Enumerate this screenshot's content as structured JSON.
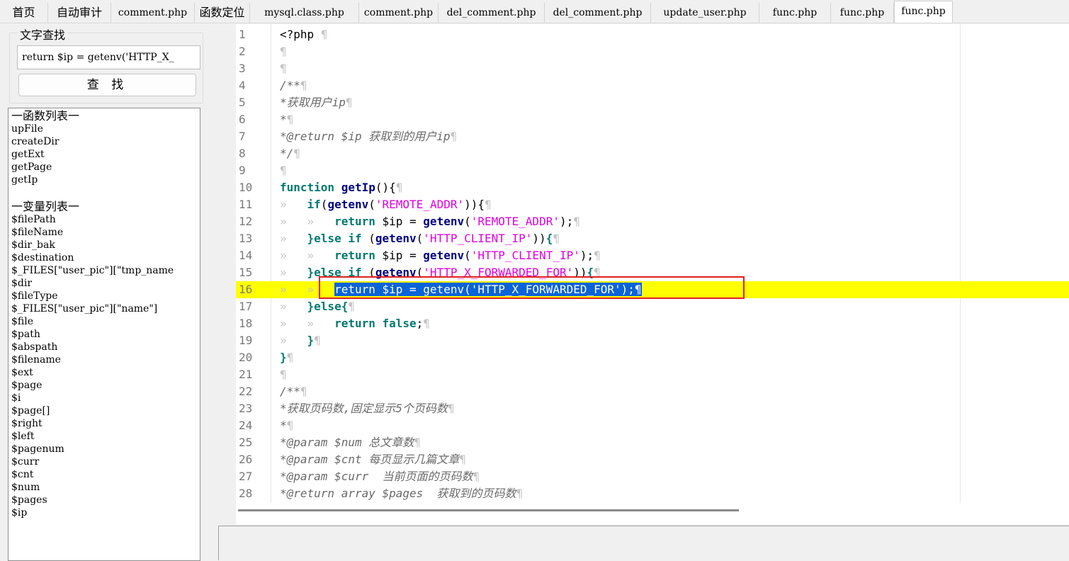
{
  "tabs": [
    {
      "label": "首页",
      "cn": true
    },
    {
      "label": "自动审计",
      "cn": true
    },
    {
      "label": "comment.php",
      "cn": false
    },
    {
      "label": "函数定位",
      "cn": true
    },
    {
      "label": "mysql.class.php",
      "cn": false
    },
    {
      "label": "comment.php",
      "cn": false
    },
    {
      "label": "del_comment.php",
      "cn": false
    },
    {
      "label": "del_comment.php",
      "cn": false
    },
    {
      "label": "update_user.php",
      "cn": false
    },
    {
      "label": "func.php",
      "cn": false
    },
    {
      "label": "func.php",
      "cn": false
    },
    {
      "label": "func.php",
      "cn": false,
      "active": true
    }
  ],
  "search": {
    "legend": "文字查找",
    "value": "return $ip = getenv('HTTP_X_",
    "button_label": "查 找"
  },
  "functions": {
    "header": "一函数列表一",
    "items": [
      "upFile",
      "createDir",
      "getExt",
      "getPage",
      "getIp"
    ]
  },
  "variables": {
    "header": "一变量列表一",
    "items": [
      "$filePath",
      "$fileName",
      "$dir_bak",
      "$destination",
      "$_FILES[\"user_pic\"][\"tmp_name",
      "$dir",
      "$fileType",
      "$_FILES[\"user_pic\"][\"name\"]",
      "$file",
      "$path",
      "$abspath",
      "$filename",
      "$ext",
      "$page",
      "$i",
      "$page[]",
      "$right",
      "$left",
      "$pagenum",
      "$curr",
      "$cnt",
      "$num",
      "$pages",
      "$ip"
    ]
  },
  "editor": {
    "highlighted_line": 16,
    "lines": [
      [
        [
          "op",
          "<?php"
        ],
        [
          "ws",
          " ¶"
        ]
      ],
      [
        [
          "ws",
          "¶"
        ]
      ],
      [
        [
          "ws",
          "¶"
        ]
      ],
      [
        [
          "cm",
          "/**"
        ],
        [
          "ws",
          "¶"
        ]
      ],
      [
        [
          "cm",
          "*获取用户ip"
        ],
        [
          "ws",
          "¶"
        ]
      ],
      [
        [
          "cm",
          "*"
        ],
        [
          "ws",
          "¶"
        ]
      ],
      [
        [
          "cm",
          "*@return $ip 获取到的用户ip"
        ],
        [
          "ws",
          "¶"
        ]
      ],
      [
        [
          "cm",
          "*/"
        ],
        [
          "ws",
          "¶"
        ]
      ],
      [
        [
          "ws",
          "¶"
        ]
      ],
      [
        [
          "kw",
          "function"
        ],
        [
          "op",
          " "
        ],
        [
          "fn",
          "getIp"
        ],
        [
          "op",
          "(){"
        ],
        [
          "ws",
          "¶"
        ]
      ],
      [
        [
          "ws",
          "»   "
        ],
        [
          "kw",
          "if"
        ],
        [
          "op",
          "("
        ],
        [
          "fn",
          "getenv"
        ],
        [
          "op",
          "("
        ],
        [
          "str",
          "'REMOTE_ADDR'"
        ],
        [
          "op",
          ")){"
        ],
        [
          "ws",
          "¶"
        ]
      ],
      [
        [
          "ws",
          "»   »   "
        ],
        [
          "kw",
          "return"
        ],
        [
          "op",
          " $ip = "
        ],
        [
          "fn",
          "getenv"
        ],
        [
          "op",
          "("
        ],
        [
          "str",
          "'REMOTE_ADDR'"
        ],
        [
          "op",
          ");"
        ],
        [
          "ws",
          "¶"
        ]
      ],
      [
        [
          "ws",
          "»   "
        ],
        [
          "kw",
          "}else if"
        ],
        [
          "op",
          " ("
        ],
        [
          "fn",
          "getenv"
        ],
        [
          "op",
          "("
        ],
        [
          "str",
          "'HTTP_CLIENT_IP'"
        ],
        [
          "op",
          "))"
        ],
        [
          "kw",
          "{"
        ],
        [
          "ws",
          "¶"
        ]
      ],
      [
        [
          "ws",
          "»   »   "
        ],
        [
          "kw",
          "return"
        ],
        [
          "op",
          " $ip = "
        ],
        [
          "fn",
          "getenv"
        ],
        [
          "op",
          "("
        ],
        [
          "str",
          "'HTTP_CLIENT_IP'"
        ],
        [
          "op",
          ");"
        ],
        [
          "ws",
          "¶"
        ]
      ],
      [
        [
          "ws",
          "»   "
        ],
        [
          "kw",
          "}else if"
        ],
        [
          "op",
          " ("
        ],
        [
          "fn",
          "getenv"
        ],
        [
          "op",
          "("
        ],
        [
          "str",
          "'HTTP_X_FORWARDED_FOR'"
        ],
        [
          "op",
          "))"
        ],
        [
          "kw",
          "{"
        ],
        [
          "ws",
          "¶"
        ]
      ],
      [
        [
          "ws",
          "»   »   "
        ],
        [
          "sel",
          "return $ip = getenv('HTTP_X_FORWARDED_FOR');"
        ],
        [
          "sel",
          "¶"
        ]
      ],
      [
        [
          "ws",
          "»   "
        ],
        [
          "kw",
          "}else{"
        ],
        [
          "ws",
          "¶"
        ]
      ],
      [
        [
          "ws",
          "»   »   "
        ],
        [
          "kw",
          "return false"
        ],
        [
          "op",
          ";"
        ],
        [
          "ws",
          "¶"
        ]
      ],
      [
        [
          "ws",
          "»   "
        ],
        [
          "kw",
          "}"
        ],
        [
          "ws",
          "¶"
        ]
      ],
      [
        [
          "kw",
          "}"
        ],
        [
          "ws",
          "¶"
        ]
      ],
      [
        [
          "ws",
          "¶"
        ]
      ],
      [
        [
          "cm",
          "/**"
        ],
        [
          "ws",
          "¶"
        ]
      ],
      [
        [
          "cm",
          "*获取页码数,固定显示5个页码数"
        ],
        [
          "ws",
          "¶"
        ]
      ],
      [
        [
          "cm",
          "*"
        ],
        [
          "ws",
          "¶"
        ]
      ],
      [
        [
          "cm",
          "*@param $num 总文章数"
        ],
        [
          "ws",
          "¶"
        ]
      ],
      [
        [
          "cm",
          "*@param $cnt 每页显示几篇文章"
        ],
        [
          "ws",
          "¶"
        ]
      ],
      [
        [
          "cm",
          "*@param $curr  当前页面的页码数"
        ],
        [
          "ws",
          "¶"
        ]
      ],
      [
        [
          "cm",
          "*@return array $pages  获取到的页码数"
        ],
        [
          "ws",
          "¶"
        ]
      ]
    ]
  }
}
